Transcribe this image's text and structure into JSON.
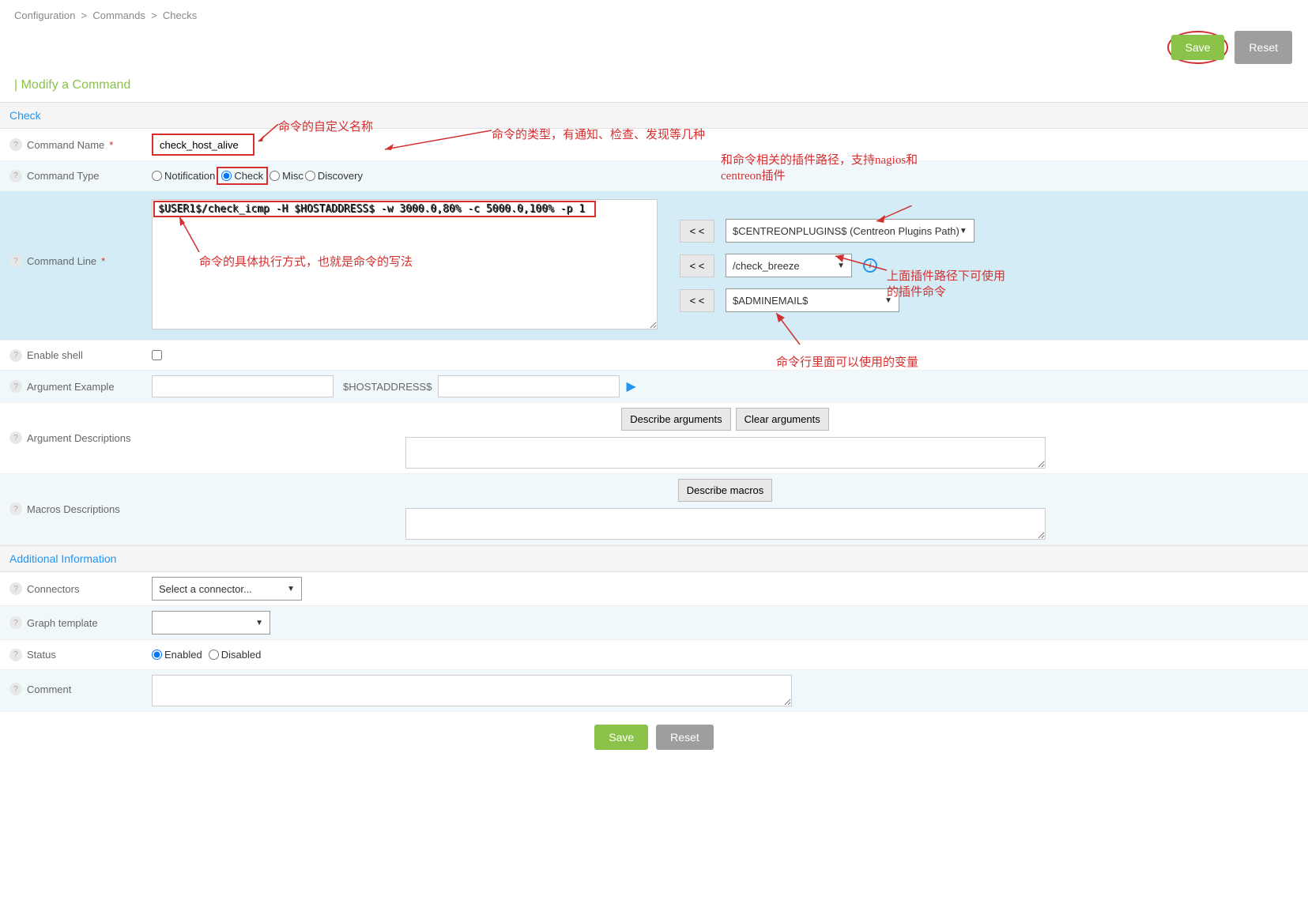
{
  "breadcrumb": {
    "a": "Configuration",
    "b": "Commands",
    "c": "Checks"
  },
  "buttons": {
    "save": "Save",
    "reset": "Reset",
    "describe_args": "Describe arguments",
    "clear_args": "Clear arguments",
    "describe_macros": "Describe macros",
    "insert": "< <"
  },
  "page_title": "| Modify a Command",
  "sections": {
    "check": "Check",
    "additional": "Additional Information"
  },
  "labels": {
    "command_name": "Command Name",
    "command_type": "Command Type",
    "command_line": "Command Line",
    "enable_shell": "Enable shell",
    "argument_example": "Argument Example",
    "argument_descriptions": "Argument Descriptions",
    "macros_descriptions": "Macros Descriptions",
    "connectors": "Connectors",
    "graph_template": "Graph template",
    "status": "Status",
    "comment": "Comment"
  },
  "values": {
    "command_name": "check_host_alive",
    "command_line": "$USER1$/check_icmp -H $HOSTADDRESS$ -w 3000.0,80% -c 5000.0,100% -p 1",
    "hostaddress_macro": "$HOSTADDRESS$",
    "plugin_path": "$CENTREONPLUGINS$ (Centreon Plugins Path)",
    "plugin_cmd": "/check_breeze",
    "variable": "$ADMINEMAIL$",
    "connector_placeholder": "Select a connector...",
    "argument_example": ""
  },
  "radios": {
    "types": [
      "Notification",
      "Check",
      "Misc",
      "Discovery"
    ],
    "status": [
      "Enabled",
      "Disabled"
    ]
  },
  "annotations": {
    "a1": "命令的自定义名称",
    "a2": "命令的类型，有通知、检查、发现等几种",
    "a3": "和命令相关的插件路径，支持nagios和",
    "a3b": "centreon插件",
    "a4": "命令的具体执行方式，也就是命令的写法",
    "a5": "上面插件路径下可使用",
    "a5b": "的插件命令",
    "a6": "命令行里面可以使用的变量"
  }
}
